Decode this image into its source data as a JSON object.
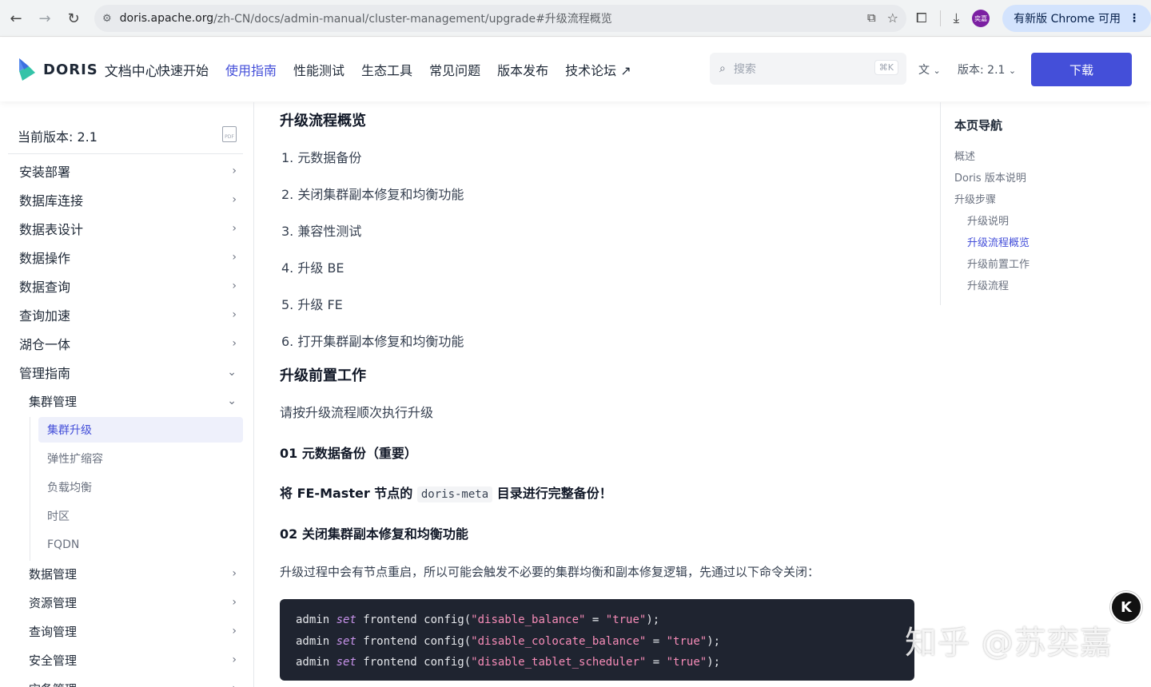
{
  "browser": {
    "url_host": "doris.apache.org",
    "url_path": "/zh-CN/docs/admin-manual/cluster-management/upgrade#升级流程概览",
    "avatar_text": "奕嘉",
    "update_label": "有新版 Chrome 可用"
  },
  "header": {
    "logo_text": "DORIS",
    "logo_sub": "文档中心",
    "nav": [
      "快速开始",
      "使用指南",
      "性能测试",
      "生态工具",
      "常见问题",
      "版本发布",
      "技术论坛"
    ],
    "active_nav": "使用指南",
    "search_placeholder": "搜索",
    "search_shortcut": "⌘K",
    "version_label": "版本: 2.1",
    "download_label": "下载",
    "accent_color": "#444fd9"
  },
  "sidebar": {
    "current_version": "当前版本: 2.1",
    "pdf_label": "PDF",
    "items": [
      {
        "label": "安装部署"
      },
      {
        "label": "数据库连接"
      },
      {
        "label": "数据表设计"
      },
      {
        "label": "数据操作"
      },
      {
        "label": "数据查询"
      },
      {
        "label": "查询加速"
      },
      {
        "label": "湖仓一体"
      },
      {
        "label": "管理指南"
      }
    ],
    "sub_items": [
      {
        "label": "集群管理"
      }
    ],
    "leaf_items": [
      {
        "label": "集群升级"
      },
      {
        "label": "弹性扩缩容"
      },
      {
        "label": "负载均衡"
      },
      {
        "label": "时区"
      },
      {
        "label": "FQDN"
      }
    ],
    "more_sub_items": [
      {
        "label": "数据管理"
      },
      {
        "label": "资源管理"
      },
      {
        "label": "查询管理"
      },
      {
        "label": "安全管理"
      },
      {
        "label": "灾备管理"
      }
    ]
  },
  "content": {
    "h_overview": "升级流程概览",
    "steps": [
      "1. 元数据备份",
      "2. 关闭集群副本修复和均衡功能",
      "3. 兼容性测试",
      "4. 升级 BE",
      "5. 升级 FE",
      "6. 打开集群副本修复和均衡功能"
    ],
    "h_prep": "升级前置工作",
    "prep_text": "请按升级流程顺次执行升级",
    "s01": "01 元数据备份（重要）",
    "backup_pre": "将 FE-Master 节点的",
    "backup_code": "doris-meta",
    "backup_post": "目录进行完整备份！",
    "s02": "02 关闭集群副本修复和均衡功能",
    "s02_text": "升级过程中会有节点重启，所以可能会触发不必要的集群均衡和副本修复逻辑，先通过以下命令关闭：",
    "code_lines": [
      {
        "a": "admin ",
        "kw": "set",
        "b": " frontend config(",
        "s1": "\"disable_balance\"",
        "c": " = ",
        "s2": "\"true\"",
        "d": ");"
      },
      {
        "a": "admin ",
        "kw": "set",
        "b": " frontend config(",
        "s1": "\"disable_colocate_balance\"",
        "c": " = ",
        "s2": "\"true\"",
        "d": ");"
      },
      {
        "a": "admin ",
        "kw": "set",
        "b": " frontend config(",
        "s1": "\"disable_tablet_scheduler\"",
        "c": " = ",
        "s2": "\"true\"",
        "d": ");"
      }
    ]
  },
  "toc": {
    "title": "本页导航",
    "items": [
      "概述",
      "Doris 版本说明",
      "升级步骤"
    ],
    "sub_items": [
      "升级说明",
      "升级流程概览",
      "升级前置工作",
      "升级流程"
    ],
    "active": "升级流程概览"
  },
  "watermark": "知乎 @苏奕嘉",
  "float_button_label": "K"
}
